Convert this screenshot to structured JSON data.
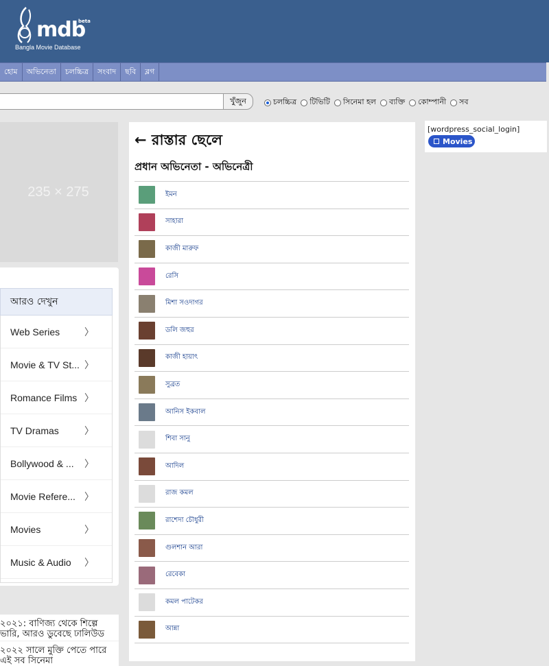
{
  "brand": {
    "name": "mdb",
    "beta": "beta",
    "tagline": "Bangla Movie Database"
  },
  "nav": {
    "items": [
      {
        "label": "হোম"
      },
      {
        "label": "অভিনেতা"
      },
      {
        "label": "চলচ্চিত্র"
      },
      {
        "label": "সংবাদ"
      },
      {
        "label": "ছবি"
      },
      {
        "label": "ব্লগ"
      }
    ]
  },
  "search": {
    "value": "",
    "placeholder": "",
    "button_label": "খুঁজুন",
    "options": [
      {
        "label": "চলচ্চিত্র",
        "checked": true
      },
      {
        "label": "টিভিটি",
        "checked": false
      },
      {
        "label": "সিনেমা হল",
        "checked": false
      },
      {
        "label": "ব্যক্তি",
        "checked": false
      },
      {
        "label": "কোম্পানী",
        "checked": false
      },
      {
        "label": "সব",
        "checked": false
      }
    ]
  },
  "ad": {
    "label": "235 × 275"
  },
  "see_more": {
    "title": "আরও দেখুন",
    "items": [
      {
        "label": "Web Series"
      },
      {
        "label": "Movie & TV St..."
      },
      {
        "label": "Romance Films"
      },
      {
        "label": "TV Dramas"
      },
      {
        "label": "Bollywood & ..."
      },
      {
        "label": "Movie Refere..."
      },
      {
        "label": "Movies"
      },
      {
        "label": "Music & Audio"
      }
    ]
  },
  "news": {
    "items": [
      {
        "text": "২০২১: বাণিজ্য থেকে শিল্পে ভারি, আরও ডুবেছে ঢালিউড"
      },
      {
        "text": "২০২২ সালে মুক্তি পেতে পারে এই সব সিনেমা"
      }
    ]
  },
  "main": {
    "title": "← রাস্তার ছেলে",
    "subtitle": "প্রধান অভিনেতা - অভিনেত্রী",
    "cast": [
      {
        "name": "ইমন",
        "color": "#5a9e7a"
      },
      {
        "name": "সাহারা",
        "color": "#b0405a"
      },
      {
        "name": "কাজী মারুফ",
        "color": "#7a6a4a"
      },
      {
        "name": "রেসি",
        "color": "#c94a9a"
      },
      {
        "name": "মিশা সওদাগর",
        "color": "#8a8070"
      },
      {
        "name": "ডলি জহুর",
        "color": "#6a4030"
      },
      {
        "name": "কাজী হায়াৎ",
        "color": "#5a3a2a"
      },
      {
        "name": "সুব্রত",
        "color": "#8a7a5a"
      },
      {
        "name": "আনিস ইকবাল",
        "color": "#6a7a8a"
      },
      {
        "name": "শিবা সানু",
        "color": "#dcdcdc"
      },
      {
        "name": "আদিল",
        "color": "#7a4a3a"
      },
      {
        "name": "রাজ কমল",
        "color": "#dcdcdc"
      },
      {
        "name": "রাশেদা চৌধুরী",
        "color": "#6a8a5a"
      },
      {
        "name": "গুলশান আরা",
        "color": "#8a5a4a"
      },
      {
        "name": "রেবেকা",
        "color": "#9a6a7a"
      },
      {
        "name": "কমল পাটেকর",
        "color": "#dcdcdc"
      },
      {
        "name": "আন্না",
        "color": "#7a5a3a"
      }
    ]
  },
  "right": {
    "text": "[wordpress_social_login]",
    "button_label": "Movies"
  }
}
